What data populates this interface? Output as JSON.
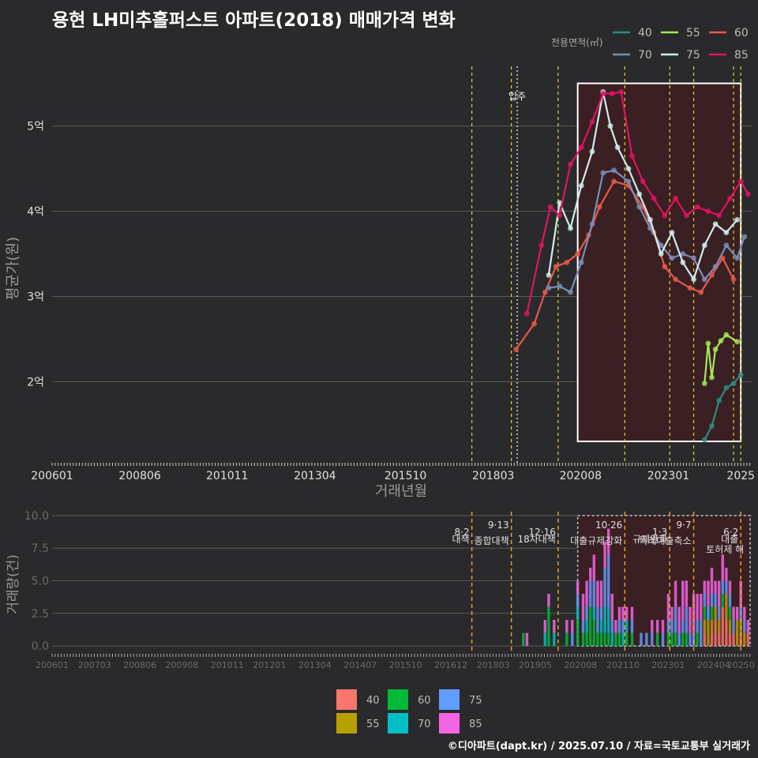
{
  "title": "용현 LH미추홀퍼스트 아파트(2018) 매매가격 변화",
  "credit": "©디아파트(dapt.kr) / 2025.07.10 / 자료=국토교통부 실거래가",
  "colors": {
    "background": "#2a2a2c",
    "grid": "#5a5a5a",
    "highlight_fill": "#3a1f23",
    "highlight_stroke": "#ffffff",
    "vline_policy": "#e8d32a",
    "vline_move_in": "#c8c8d8",
    "vline_orange": "#e8a020"
  },
  "chart_data": [
    {
      "type": "line",
      "title": "용현 LH미추홀퍼스트 아파트(2018) 매매가격 변화",
      "xlabel": "거래년월",
      "ylabel": "평균가(원)",
      "xlim": [
        2006.0,
        2025.3
      ],
      "ylim": [
        1.05,
        5.7
      ],
      "y_unit": "억",
      "yticks": [
        2,
        3,
        4,
        5
      ],
      "ytick_labels": [
        "2억",
        "3억",
        "4억",
        "5억"
      ],
      "xticks": [
        2006.0,
        2008.42,
        2010.83,
        2013.25,
        2015.75,
        2018.17,
        2020.58,
        2023.0,
        2025.0
      ],
      "xtick_labels": [
        "200601",
        "200806",
        "201011",
        "201304",
        "201510",
        "201803",
        "202008",
        "202301",
        "2025"
      ],
      "legend_title": "전용면적(㎡)",
      "legend_position": "top-right",
      "grid": true,
      "highlight_range": [
        2020.5,
        2025.0
      ],
      "policy_lines": [
        2017.58,
        2018.67,
        2019.96,
        2021.8,
        2023.04,
        2023.7,
        2024.8,
        2025.0
      ],
      "move_in_line": {
        "x": 2018.83,
        "label": "입주"
      },
      "series": [
        {
          "name": "40",
          "color": "#2e8a86",
          "x": [
            2024.0,
            2024.2,
            2024.4,
            2024.6,
            2024.8,
            2025.0
          ],
          "y": [
            1.32,
            1.48,
            1.78,
            1.93,
            1.98,
            2.08
          ]
        },
        {
          "name": "55",
          "color": "#a8e65a",
          "x": [
            2024.0,
            2024.1,
            2024.2,
            2024.3,
            2024.45,
            2024.6,
            2024.9
          ],
          "y": [
            1.98,
            2.45,
            2.05,
            2.38,
            2.48,
            2.55,
            2.47
          ]
        },
        {
          "name": "60",
          "color": "#e8584a",
          "x": [
            2018.8,
            2019.3,
            2019.6,
            2019.9,
            2020.2,
            2020.5,
            2020.8,
            2021.1,
            2021.5,
            2021.9,
            2022.3,
            2022.6,
            2022.9,
            2023.2,
            2023.6,
            2023.9,
            2024.2,
            2024.5,
            2024.8
          ],
          "y": [
            2.38,
            2.68,
            3.05,
            3.35,
            3.4,
            3.5,
            3.72,
            4.05,
            4.35,
            4.3,
            4.05,
            3.75,
            3.35,
            3.2,
            3.1,
            3.05,
            3.25,
            3.45,
            3.2
          ]
        },
        {
          "name": "70",
          "color": "#7a8fb5",
          "x": [
            2019.7,
            2020.0,
            2020.3,
            2020.6,
            2020.9,
            2021.2,
            2021.5,
            2021.9,
            2022.2,
            2022.5,
            2022.8,
            2023.1,
            2023.4,
            2023.7,
            2024.0,
            2024.3,
            2024.6,
            2024.9,
            2025.1
          ],
          "y": [
            3.1,
            3.12,
            3.05,
            3.4,
            3.85,
            4.45,
            4.48,
            4.35,
            4.05,
            3.8,
            3.6,
            3.45,
            3.5,
            3.45,
            3.2,
            3.35,
            3.6,
            3.45,
            3.7
          ]
        },
        {
          "name": "75",
          "color": "#cfeeee",
          "x": [
            2019.7,
            2020.0,
            2020.3,
            2020.6,
            2020.9,
            2021.2,
            2021.4,
            2021.6,
            2021.9,
            2022.2,
            2022.5,
            2022.8,
            2023.1,
            2023.4,
            2023.7,
            2024.0,
            2024.3,
            2024.6,
            2024.9
          ],
          "y": [
            3.25,
            4.1,
            3.8,
            4.3,
            4.7,
            5.4,
            5.0,
            4.75,
            4.5,
            4.2,
            3.9,
            3.5,
            3.75,
            3.4,
            3.2,
            3.6,
            3.85,
            3.75,
            3.9
          ]
        },
        {
          "name": "85",
          "color": "#e01460",
          "x": [
            2019.1,
            2019.5,
            2019.75,
            2020.0,
            2020.3,
            2020.6,
            2020.9,
            2021.2,
            2021.45,
            2021.7,
            2022.0,
            2022.3,
            2022.6,
            2022.9,
            2023.2,
            2023.5,
            2023.8,
            2024.1,
            2024.4,
            2024.7,
            2025.0,
            2025.2
          ],
          "y": [
            2.8,
            3.6,
            4.05,
            3.95,
            4.55,
            4.75,
            5.05,
            5.38,
            5.38,
            5.4,
            4.65,
            4.35,
            4.15,
            3.95,
            4.15,
            3.95,
            4.05,
            4.0,
            3.95,
            4.15,
            4.35,
            4.2
          ]
        }
      ]
    },
    {
      "type": "bar",
      "xlabel": "",
      "ylabel": "거래량(건)",
      "xlim": [
        2006.0,
        2025.3
      ],
      "ylim": [
        -0.6,
        10.3
      ],
      "yticks": [
        0.0,
        2.5,
        5.0,
        7.5,
        10.0
      ],
      "ytick_labels": [
        "0.0",
        "2.5",
        "5.0",
        "7.5",
        "10.0"
      ],
      "xticks": [
        2006.0,
        2007.17,
        2008.42,
        2009.58,
        2010.83,
        2012.0,
        2013.25,
        2014.5,
        2015.75,
        2017.0,
        2018.17,
        2019.33,
        2020.58,
        2021.75,
        2023.0,
        2024.25,
        2025.0
      ],
      "xtick_labels": [
        "200601",
        "200703",
        "200806",
        "200908",
        "201011",
        "201201",
        "201304",
        "201407",
        "201510",
        "201612",
        "201803",
        "201905",
        "202008",
        "202110",
        "202301",
        "202404",
        "20250"
      ],
      "highlight_range": [
        2020.5,
        2025.3
      ],
      "legend_position": "bottom",
      "policy_events": [
        {
          "x": 2017.58,
          "label": "8·2 대책"
        },
        {
          "x": 2018.67,
          "label": "9·13 종합대책"
        },
        {
          "x": 2019.96,
          "label": "12·16 18차대책"
        },
        {
          "x": 2021.8,
          "label": "10·26 대출규제강화"
        },
        {
          "x": 2023.04,
          "label": "1·3 규제완화"
        },
        {
          "x": 2023.7,
          "label": "9·7 특례대출축소"
        },
        {
          "x": 2025.0,
          "label": "6·2 대출"
        }
      ],
      "policy_extra_labels": [
        "토허제 해"
      ],
      "series": [
        {
          "name": "40",
          "color": "#f8766d"
        },
        {
          "name": "55",
          "color": "#b79f00"
        },
        {
          "name": "60",
          "color": "#00ba38"
        },
        {
          "name": "70",
          "color": "#00bfc4"
        },
        {
          "name": "75",
          "color": "#619cff"
        },
        {
          "name": "85",
          "color": "#f564e3"
        }
      ],
      "months": [
        2019.0,
        2019.1,
        2019.6,
        2019.7,
        2019.85,
        2020.0,
        2020.2,
        2020.35,
        2020.5,
        2020.65,
        2020.75,
        2020.85,
        2020.95,
        2021.05,
        2021.15,
        2021.25,
        2021.35,
        2021.45,
        2021.55,
        2021.65,
        2021.75,
        2021.85,
        2022.0,
        2022.25,
        2022.4,
        2022.55,
        2022.7,
        2022.85,
        2023.0,
        2023.1,
        2023.2,
        2023.3,
        2023.4,
        2023.5,
        2023.6,
        2023.7,
        2023.8,
        2023.9,
        2024.0,
        2024.1,
        2024.2,
        2024.3,
        2024.4,
        2024.5,
        2024.6,
        2024.7,
        2024.8,
        2024.9,
        2025.0,
        2025.1,
        2025.2
      ],
      "counts": {
        "40": [
          0,
          0,
          0,
          0,
          0,
          0,
          0,
          0,
          0,
          0,
          0,
          0,
          0,
          0,
          0,
          0,
          0,
          0,
          0,
          0,
          0,
          0,
          0,
          0,
          0,
          0,
          0,
          0,
          0,
          0,
          0,
          0,
          0,
          0,
          0,
          0,
          0,
          0,
          1,
          0,
          1,
          2,
          1,
          3,
          2,
          1,
          1,
          0,
          1,
          0,
          1
        ],
        "55": [
          0,
          0,
          0,
          0,
          0,
          0,
          0,
          0,
          0,
          0,
          0,
          0,
          0,
          0,
          0,
          0,
          0,
          0,
          0,
          0,
          0,
          0,
          0,
          0,
          0,
          0,
          0,
          0,
          0,
          0,
          0,
          0,
          0,
          0,
          0,
          0,
          0,
          0,
          1,
          2,
          1,
          1,
          1,
          0,
          2,
          1,
          0,
          2,
          1,
          1,
          0
        ],
        "60": [
          1,
          0,
          0,
          3,
          0,
          0,
          1,
          0,
          2,
          1,
          1,
          3,
          2,
          1,
          1,
          1,
          1,
          0,
          1,
          1,
          0,
          1,
          1,
          0,
          0,
          0,
          1,
          0,
          1,
          1,
          1,
          0,
          1,
          1,
          0,
          0,
          1,
          0,
          1,
          0,
          1,
          0,
          0,
          1,
          0,
          1,
          0,
          0,
          0,
          0,
          0
        ],
        "70": [
          0,
          0,
          1,
          0,
          1,
          0,
          0,
          0,
          1,
          0,
          1,
          0,
          1,
          0,
          1,
          2,
          2,
          1,
          0,
          0,
          1,
          1,
          0,
          0,
          0,
          0,
          0,
          0,
          0,
          0,
          0,
          0,
          0,
          0,
          0,
          0,
          0,
          0,
          0,
          0,
          0,
          0,
          0,
          0,
          0,
          0,
          0,
          0,
          0,
          0,
          0
        ],
        "75": [
          0,
          0,
          0,
          0,
          0,
          0,
          0,
          1,
          1,
          1,
          1,
          2,
          2,
          2,
          1,
          3,
          4,
          1,
          0,
          1,
          1,
          0,
          1,
          1,
          1,
          1,
          0,
          1,
          1,
          1,
          2,
          1,
          1,
          2,
          1,
          1,
          1,
          2,
          1,
          1,
          1,
          1,
          1,
          1,
          1,
          1,
          1,
          0,
          1,
          1,
          0
        ],
        "85": [
          0,
          1,
          1,
          1,
          1,
          0,
          1,
          1,
          1,
          2,
          2,
          1,
          2,
          2,
          2,
          2,
          2,
          2,
          1,
          1,
          1,
          1,
          1,
          0,
          0,
          1,
          1,
          1,
          2,
          1,
          2,
          2,
          3,
          2,
          2,
          3,
          2,
          2,
          1,
          2,
          2,
          1,
          2,
          2,
          1,
          1,
          1,
          1,
          2,
          1,
          1
        ]
      }
    }
  ]
}
